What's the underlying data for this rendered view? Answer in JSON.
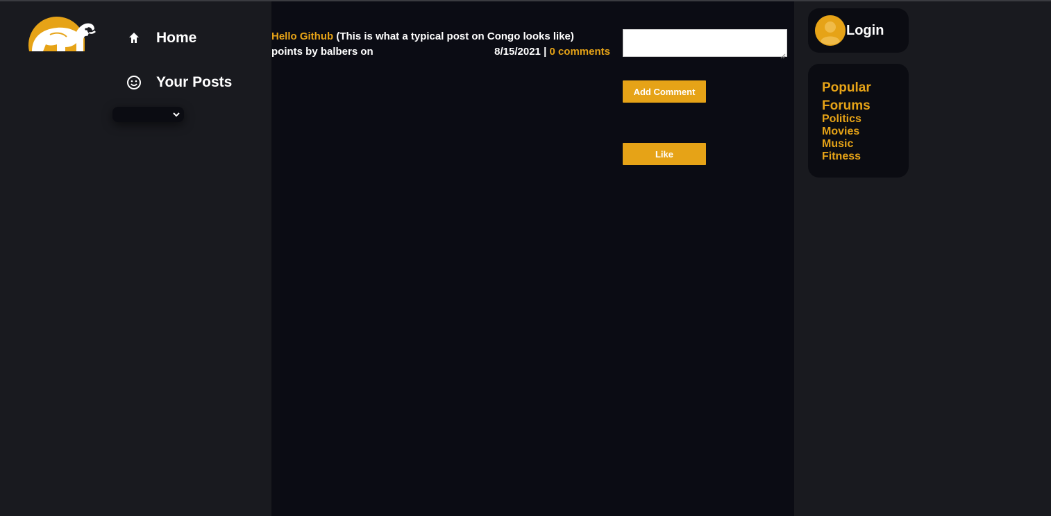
{
  "nav": {
    "items": [
      {
        "label": "Home",
        "icon": "home-icon"
      },
      {
        "label": "Your Posts",
        "icon": "smiley-icon"
      }
    ],
    "forum_select": {
      "selected": ""
    }
  },
  "post": {
    "title": "Hello Github",
    "body": " (This is what a typical post on Congo looks like)",
    "byline": "points by balbers on",
    "date": "8/15/2021",
    "separator": " | ",
    "comments_link": "0 comments"
  },
  "actions": {
    "comment_placeholder": "",
    "add_comment_label": "Add Comment",
    "like_label": "Like"
  },
  "user": {
    "login_label": "Login",
    "avatar_icon": "user-avatar-icon"
  },
  "forums": {
    "title": "Popular Forums",
    "items": [
      "Politics",
      "Movies",
      "Music",
      "Fitness"
    ]
  },
  "colors": {
    "accent": "#e6a317",
    "main_bg": "#0b0c14",
    "side_bg": "#191a1f",
    "card_bg": "#0b0c12"
  }
}
